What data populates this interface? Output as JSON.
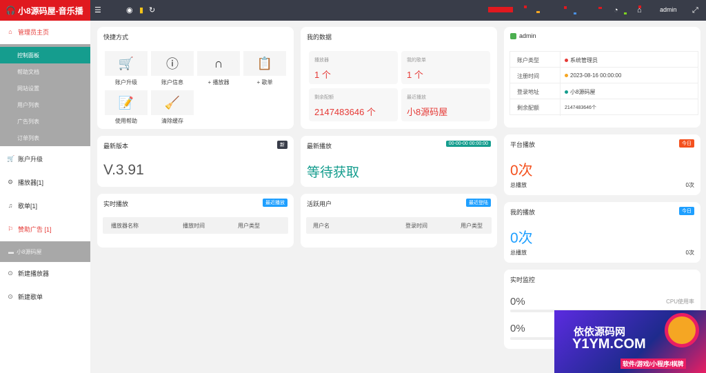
{
  "app": {
    "title": "小8源码屋-音乐播"
  },
  "header": {
    "user": "admin",
    "colors": {
      "bar": "#393d49",
      "brand": "#e0191f"
    }
  },
  "sidebar": {
    "admin_home": "管理员主页",
    "sub_items": [
      "控制面板",
      "帮助文档",
      "网站设置",
      "用户列表",
      "广告列表",
      "订单列表"
    ],
    "items": [
      {
        "label": "账户升级",
        "icon": "cart-icon"
      },
      {
        "label": "播放器[1]",
        "icon": "gear-icon"
      },
      {
        "label": "歌单[1]",
        "icon": "music-icon"
      },
      {
        "label": "赞助广告 [1]",
        "icon": "flag-icon"
      }
    ],
    "section": "小8源码屋",
    "extra_items": [
      "新建播放器",
      "新建歌单"
    ]
  },
  "quick": {
    "title": "快捷方式",
    "items": [
      {
        "label": "账户升级",
        "icon": "cart-icon"
      },
      {
        "label": "账户信息",
        "icon": "info-icon"
      },
      {
        "label": "+ 播放器",
        "icon": "headphones-icon"
      },
      {
        "label": "+ 歌单",
        "icon": "clipboard-icon"
      },
      {
        "label": "使用帮助",
        "icon": "help-doc-icon"
      },
      {
        "label": "清除缓存",
        "icon": "broom-icon"
      }
    ]
  },
  "mydata": {
    "title": "我的数据",
    "boxes": [
      {
        "label": "播放器",
        "value": "1 个"
      },
      {
        "label": "我的歌单",
        "value": "1 个"
      },
      {
        "label": "剩余配额",
        "value": "2147483646 个"
      },
      {
        "label": "最近播放",
        "value": "小8源码屋"
      }
    ]
  },
  "profile": {
    "name": "admin",
    "rows": [
      {
        "k": "账户类型",
        "v": "系统管理员",
        "dot": "#e53935"
      },
      {
        "k": "注册时间",
        "v": "2023-08-16 00:00:00",
        "dot": "#f5a623"
      },
      {
        "k": "登录地址",
        "v": "小8源码屋",
        "dot": "#159d8e"
      },
      {
        "k": "剩余配额",
        "v": "2147483646个",
        "dot": ""
      }
    ]
  },
  "version": {
    "title": "最新版本",
    "badge": "新",
    "value": "V.3.91"
  },
  "latest_play": {
    "title": "最新播放",
    "badge": "00-00-00 00:00:00",
    "value": "等待获取"
  },
  "platform": {
    "title": "平台播放",
    "badge": "今日",
    "value": "0次",
    "sub": "总播放",
    "total": "0次"
  },
  "myplay": {
    "title": "我的播放",
    "badge": "今日",
    "value": "0次",
    "sub": "总播放",
    "total": "0次"
  },
  "realtime": {
    "title": "实时播放",
    "badge": "最近播放",
    "cols": [
      "播放器名称",
      "播放时间",
      "用户类型"
    ]
  },
  "active_users": {
    "title": "活跃用户",
    "badge": "最近登陆",
    "cols": [
      "用户名",
      "登录时间",
      "用户类型"
    ]
  },
  "monitor": {
    "title": "实时监控",
    "cpu": "0%",
    "cpu_label": "CPU使用率",
    "mem": "0%",
    "cpu_fraction": 0,
    "mem_fraction": 0
  },
  "ad": {
    "line1": "依依源码网",
    "line2": "Y1YM.COM",
    "line3": "软件/游戏/小程序/棋牌"
  }
}
